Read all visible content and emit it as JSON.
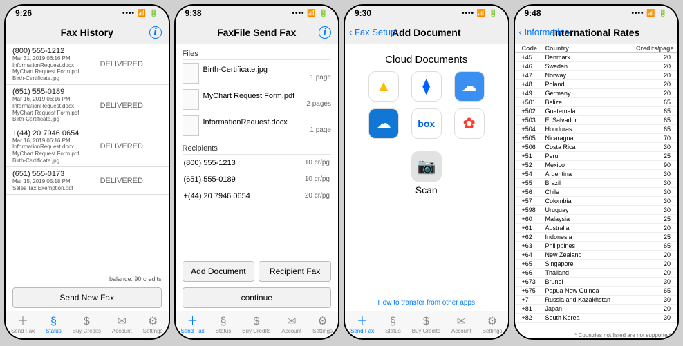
{
  "screen1": {
    "time": "9:26",
    "title": "Fax History",
    "rows": [
      {
        "number": "(800) 555-1212",
        "date": "Mar 31, 2019 06:16 PM",
        "files": "InformationRequest.docx\nMyChart Request Form.pdf\nBirth-Certificate.jpg",
        "status": "DELIVERED"
      },
      {
        "number": "(651) 555-0189",
        "date": "Mar 16, 2019 06:16 PM",
        "files": "InformationRequest.docx\nMyChart Request Form.pdf\nBirth-Certificate.jpg",
        "status": "DELIVERED"
      },
      {
        "number": "+(44) 20 7946 0654",
        "date": "Mar 16, 2019 06:16 PM",
        "files": "InformationRequest.docx\nMyChart Request Form.pdf\nBirth-Certificate.jpg",
        "status": "DELIVERED"
      },
      {
        "number": "(651) 555-0173",
        "date": "Mar 15, 2019 05:18 PM",
        "files": "Sales Tax Exemption.pdf",
        "status": "DELIVERED"
      }
    ],
    "balance": "balance: 90 credits",
    "sendNew": "Send New Fax"
  },
  "screen2": {
    "time": "9:38",
    "title": "FaxFile Send Fax",
    "filesHeader": "Files",
    "files": [
      {
        "name": "Birth-Certificate.jpg",
        "pages": "1 page"
      },
      {
        "name": "MyChart Request Form.pdf",
        "pages": "2 pages"
      },
      {
        "name": "InformationRequest.docx",
        "pages": "1 page"
      }
    ],
    "recipientsHeader": "Recipients",
    "recipients": [
      {
        "num": "(800) 555-1213",
        "rate": "10 cr/pg"
      },
      {
        "num": "(651) 555-0189",
        "rate": "10 cr/pg"
      },
      {
        "num": "+(44) 20 7946 0654",
        "rate": "20 cr/pg"
      }
    ],
    "addDoc": "Add Document",
    "recipFax": "Recipient Fax",
    "continue": "continue"
  },
  "screen3": {
    "time": "9:30",
    "back": "Fax Setup",
    "title": "Add Document",
    "cloudTitle": "Cloud Documents",
    "icons": [
      {
        "name": "google-drive-icon",
        "bg": "#ffffff",
        "glyph": "▲",
        "fg": "#fbbc05"
      },
      {
        "name": "dropbox-icon",
        "bg": "#ffffff",
        "glyph": "⧫",
        "fg": "#0061ff"
      },
      {
        "name": "icloud-icon",
        "bg": "#3b8ff0",
        "glyph": "☁",
        "fg": "#ffffff"
      },
      {
        "name": "onedrive-icon",
        "bg": "#1078d4",
        "glyph": "☁",
        "fg": "#ffffff"
      },
      {
        "name": "box-icon",
        "bg": "#ffffff",
        "glyph": "box",
        "fg": "#0061d5"
      },
      {
        "name": "photos-icon",
        "bg": "#ffffff",
        "glyph": "✿",
        "fg": "#ff3b30"
      }
    ],
    "scan": "Scan",
    "transfer": "How to transfer from other apps"
  },
  "screen4": {
    "time": "9:48",
    "back": "Information",
    "title": "International Rates",
    "headers": {
      "code": "Code",
      "country": "Country",
      "credits": "Credits/page"
    },
    "rows": [
      {
        "code": "+45",
        "country": "Denmark",
        "credits": "20"
      },
      {
        "code": "+46",
        "country": "Sweden",
        "credits": "20"
      },
      {
        "code": "+47",
        "country": "Norway",
        "credits": "20"
      },
      {
        "code": "+48",
        "country": "Poland",
        "credits": "20"
      },
      {
        "code": "+49",
        "country": "Germany",
        "credits": "20"
      },
      {
        "code": "+501",
        "country": "Belize",
        "credits": "65"
      },
      {
        "code": "+502",
        "country": "Guatemala",
        "credits": "65"
      },
      {
        "code": "+503",
        "country": "El Salvador",
        "credits": "65"
      },
      {
        "code": "+504",
        "country": "Honduras",
        "credits": "65"
      },
      {
        "code": "+505",
        "country": "Nicaragua",
        "credits": "70"
      },
      {
        "code": "+506",
        "country": "Costa Rica",
        "credits": "30"
      },
      {
        "code": "+51",
        "country": "Peru",
        "credits": "25"
      },
      {
        "code": "+52",
        "country": "Mexico",
        "credits": "90"
      },
      {
        "code": "+54",
        "country": "Argentina",
        "credits": "30"
      },
      {
        "code": "+55",
        "country": "Brazil",
        "credits": "30"
      },
      {
        "code": "+56",
        "country": "Chile",
        "credits": "30"
      },
      {
        "code": "+57",
        "country": "Colombia",
        "credits": "30"
      },
      {
        "code": "+598",
        "country": "Uruguay",
        "credits": "30"
      },
      {
        "code": "+60",
        "country": "Malaysia",
        "credits": "25"
      },
      {
        "code": "+61",
        "country": "Australia",
        "credits": "20"
      },
      {
        "code": "+62",
        "country": "Indonesia",
        "credits": "25"
      },
      {
        "code": "+63",
        "country": "Philippines",
        "credits": "65"
      },
      {
        "code": "+64",
        "country": "New Zealand",
        "credits": "20"
      },
      {
        "code": "+65",
        "country": "Singapore",
        "credits": "20"
      },
      {
        "code": "+66",
        "country": "Thailand",
        "credits": "20"
      },
      {
        "code": "+673",
        "country": "Brunei",
        "credits": "30"
      },
      {
        "code": "+675",
        "country": "Papua New Guinea",
        "credits": "65"
      },
      {
        "code": "+7",
        "country": "Russia and Kazakhstan",
        "credits": "30"
      },
      {
        "code": "+81",
        "country": "Japan",
        "credits": "20"
      },
      {
        "code": "+82",
        "country": "South Korea",
        "credits": "30"
      }
    ],
    "footnote": "* Countries not listed are not supported"
  },
  "tabs": [
    {
      "label": "Send Fax",
      "icon": "＋"
    },
    {
      "label": "Status",
      "icon": "§"
    },
    {
      "label": "Buy Credits",
      "icon": "$"
    },
    {
      "label": "Account",
      "icon": "✉"
    },
    {
      "label": "Settings",
      "icon": "⚙"
    }
  ]
}
